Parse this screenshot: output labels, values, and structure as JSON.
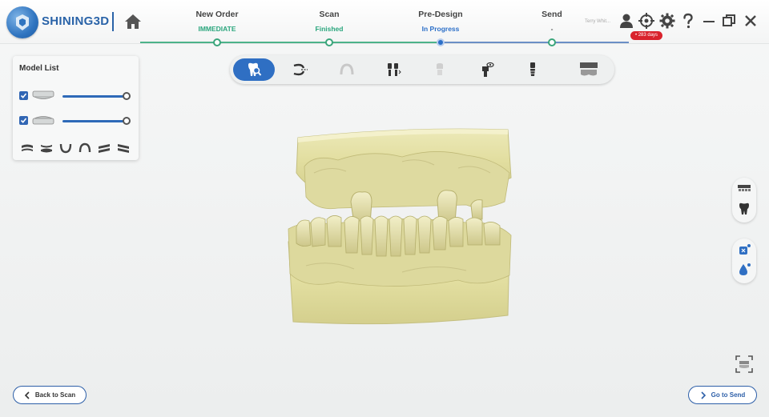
{
  "brand": {
    "name": "SHINING3D"
  },
  "workflow": {
    "steps": [
      {
        "title": "New Order",
        "status": "IMMEDIATE",
        "state": "done",
        "status_color": "#2aa67d"
      },
      {
        "title": "Scan",
        "status": "Finished",
        "state": "done",
        "status_color": "#2aa67d"
      },
      {
        "title": "Pre-Design",
        "status": "In Progress",
        "state": "in-progress",
        "status_color": "#2b6fc8"
      },
      {
        "title": "Send",
        "status": "-",
        "state": "pending",
        "status_color": "#555555"
      }
    ]
  },
  "header": {
    "user_name": "Terry Whit...",
    "license_badge": "• 283 days",
    "icons": [
      "user-icon",
      "target-icon",
      "gear-icon",
      "help-icon",
      "minimize-icon",
      "restore-icon",
      "close-icon"
    ]
  },
  "model_list": {
    "title": "Model List",
    "items": [
      {
        "name": "upper-jaw",
        "checked": true,
        "opacity": 1.0
      },
      {
        "name": "lower-jaw",
        "checked": true,
        "opacity": 1.0
      }
    ],
    "view_icons": [
      "upper-view-icon",
      "occlusion-view-icon",
      "lower-view-icon",
      "arch-view-icon",
      "left-view-icon",
      "right-view-icon"
    ]
  },
  "toolbar": {
    "active_index": 0,
    "tools": [
      "tooth-search-icon",
      "jaw-cut-icon",
      "arch-icon",
      "implant-adjust-icon",
      "tooth-dim-icon",
      "scanbody-eye-icon",
      "implant-icon",
      "model-base-icon"
    ]
  },
  "side_tools": [
    "teeth-grid-icon",
    "tooth-icon",
    "mesh-tool-icon",
    "drop-icon"
  ],
  "buttons": {
    "back": "Back to Scan",
    "next": "Go to Send"
  },
  "colors": {
    "accent": "#2f6fc3",
    "done": "#2aa67d",
    "model": "#e3dfa2",
    "badge": "#d9232d"
  }
}
